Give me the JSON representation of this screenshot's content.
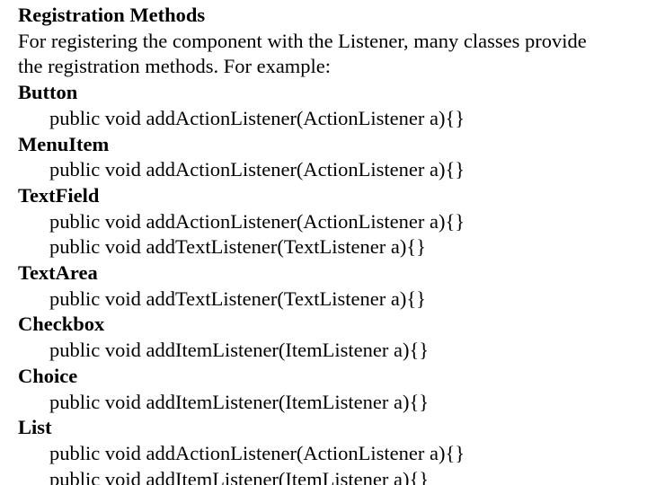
{
  "page": {
    "background_color": "#ffffff",
    "text_color": "#000000",
    "title": "Registration Methods"
  },
  "lines": [
    {
      "text": "Registration Methods",
      "style": "heading",
      "indent": "flush"
    },
    {
      "text": "For registering the component with the Listener, many classes provide",
      "style": "body",
      "indent": "flush"
    },
    {
      "text": "the registration methods. For example:",
      "style": "body",
      "indent": "flush"
    },
    {
      "text": "Button",
      "style": "heading",
      "indent": "flush"
    },
    {
      "text": "public void addActionListener(ActionListener a){}",
      "style": "code",
      "indent": "indent"
    },
    {
      "text": "MenuItem",
      "style": "heading",
      "indent": "flush"
    },
    {
      "text": "public void addActionListener(ActionListener a){}",
      "style": "code",
      "indent": "indent"
    },
    {
      "text": "TextField",
      "style": "heading",
      "indent": "flush"
    },
    {
      "text": "public void addActionListener(ActionListener a){}",
      "style": "code",
      "indent": "indent"
    },
    {
      "text": "public void addTextListener(TextListener a){}",
      "style": "code",
      "indent": "indent"
    },
    {
      "text": "TextArea",
      "style": "heading",
      "indent": "flush"
    },
    {
      "text": "public void addTextListener(TextListener a){}",
      "style": "code",
      "indent": "indent"
    },
    {
      "text": "Checkbox",
      "style": "heading",
      "indent": "flush"
    },
    {
      "text": "public void addItemListener(ItemListener a){}",
      "style": "code",
      "indent": "indent"
    },
    {
      "text": "Choice",
      "style": "heading",
      "indent": "flush"
    },
    {
      "text": "public void addItemListener(ItemListener a){}",
      "style": "code",
      "indent": "indent"
    },
    {
      "text": "List",
      "style": "heading",
      "indent": "flush"
    },
    {
      "text": "public void addActionListener(ActionListener a){}",
      "style": "code",
      "indent": "indent"
    },
    {
      "text": "public void addItemListener(ItemListener a){}",
      "style": "code",
      "indent": "indent"
    }
  ]
}
